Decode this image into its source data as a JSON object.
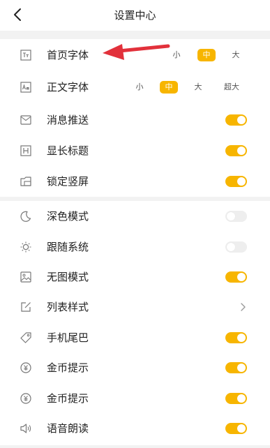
{
  "header": {
    "title": "设置中心",
    "back_icon": "chevron-left-icon"
  },
  "font_size_options": [
    "小",
    "中",
    "大",
    "超大"
  ],
  "section1": [
    {
      "key": "home_font",
      "label": "首页字体",
      "icon": "font-size-icon",
      "control": "size",
      "options": [
        "小",
        "中",
        "大"
      ],
      "selected": "中"
    },
    {
      "key": "body_font",
      "label": "正文字体",
      "icon": "text-icon",
      "control": "size",
      "options": [
        "小",
        "中",
        "大",
        "超大"
      ],
      "selected": "中"
    },
    {
      "key": "push",
      "label": "消息推送",
      "icon": "mail-icon",
      "control": "toggle",
      "on": true
    },
    {
      "key": "long_title",
      "label": "显长标题",
      "icon": "heading-icon",
      "control": "toggle",
      "on": true
    },
    {
      "key": "lock_portrait",
      "label": "锁定竖屏",
      "icon": "screen-lock-icon",
      "control": "toggle",
      "on": true
    }
  ],
  "section2": [
    {
      "key": "dark_mode",
      "label": "深色模式",
      "icon": "moon-icon",
      "control": "toggle",
      "on": false
    },
    {
      "key": "follow_system",
      "label": "跟随系统",
      "icon": "sun-icon",
      "control": "toggle",
      "on": false
    },
    {
      "key": "no_image",
      "label": "无图模式",
      "icon": "image-icon",
      "control": "toggle",
      "on": true
    },
    {
      "key": "list_style",
      "label": "列表样式",
      "icon": "edit-icon",
      "control": "chevron"
    },
    {
      "key": "phone_tail",
      "label": "手机尾巴",
      "icon": "tag-icon",
      "control": "toggle",
      "on": true
    },
    {
      "key": "coin_tip_1",
      "label": "金币提示",
      "icon": "coin-icon",
      "control": "toggle",
      "on": true
    },
    {
      "key": "coin_tip_2",
      "label": "金币提示",
      "icon": "coin-icon",
      "control": "toggle",
      "on": true
    },
    {
      "key": "voice_read",
      "label": "语音朗读",
      "icon": "speaker-icon",
      "control": "toggle",
      "on": true
    }
  ],
  "colors": {
    "accent": "#f7b500",
    "annotation_arrow": "#e2313b",
    "background": "#f2f2f2"
  }
}
